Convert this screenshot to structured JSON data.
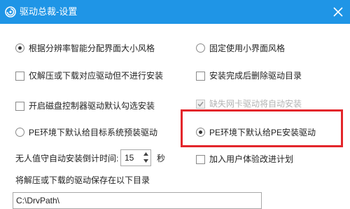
{
  "window": {
    "title": "驱动总裁-设置",
    "accent_color": "#1f95e6",
    "highlight_color": "#e3262b"
  },
  "left_options": {
    "radio_resolution": {
      "label": "根据分辨率智能分配界面大小风格",
      "selected": true
    },
    "check_extract_only": {
      "label": "仅解压或下载对应驱动但不进行安装",
      "checked": false
    },
    "check_disk_controller": {
      "label": "开启磁盘控制器驱动默认勾选安装",
      "checked": false
    },
    "radio_pe_target": {
      "label": "PE环境下默认给目标系统预装驱动",
      "selected": false
    }
  },
  "right_options": {
    "radio_fixed_small": {
      "label": "固定使用小界面风格",
      "selected": false
    },
    "check_delete_dir": {
      "label": "安装完成后删除驱动目录",
      "checked": false
    },
    "check_nic_auto": {
      "label": "缺失网卡驱动将自动安装",
      "checked": true,
      "disabled": true
    },
    "radio_pe_install": {
      "label": "PE环境下默认给PE安装驱动",
      "selected": true
    },
    "check_join_program": {
      "label": "加入用户体验改进计划",
      "checked": false
    }
  },
  "countdown": {
    "label": "无人值守自动安装倒计时间:",
    "value": "15",
    "unit": "秒"
  },
  "save_dir": {
    "label": "将解压或下载的驱动保存在以下目录",
    "value": "C:\\DrvPath\\"
  }
}
